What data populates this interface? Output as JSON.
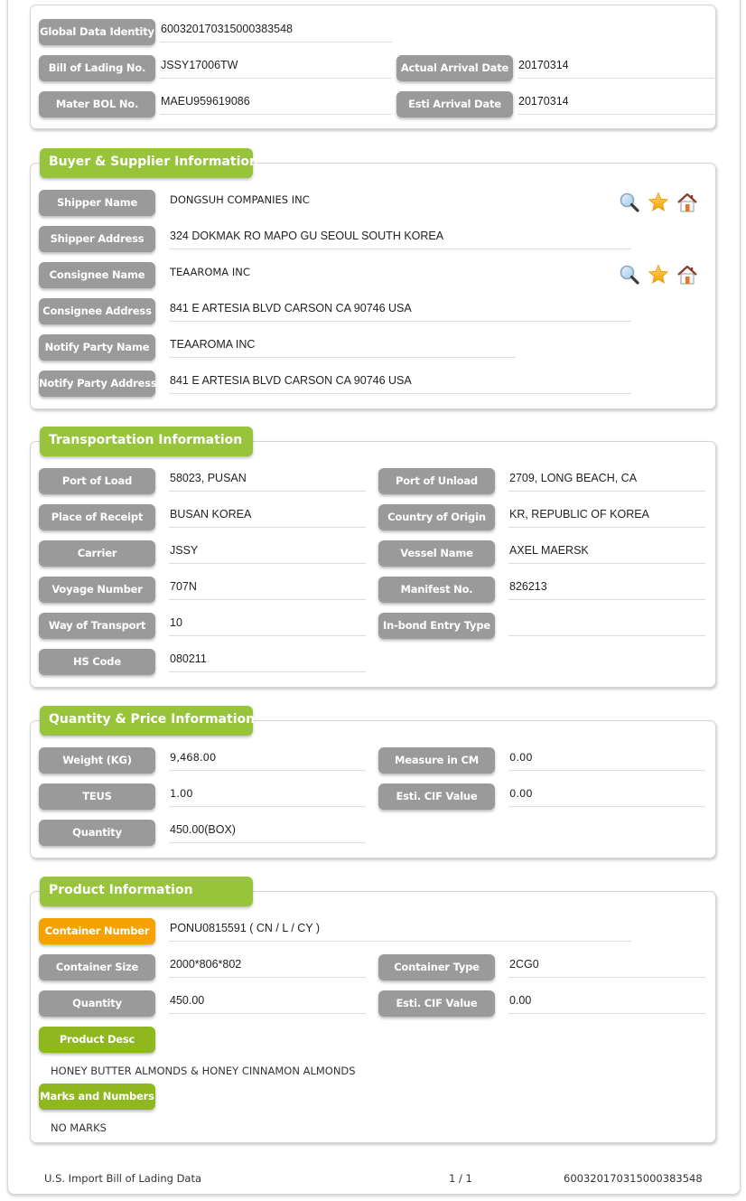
{
  "header": {
    "global_data_identity": {
      "label": "Global Data Identity",
      "value": "600320170315000383548"
    },
    "bill_of_lading": {
      "label": "Bill of Lading No.",
      "value": "JSSY17006TW"
    },
    "master_bol": {
      "label": "Mater BOL No.",
      "value": "MAEU959619086"
    },
    "actual_arrival": {
      "label": "Actual Arrival Date",
      "value": "20170314"
    },
    "esti_arrival": {
      "label": "Esti Arrival Date",
      "value": "20170314"
    }
  },
  "buyer_supplier": {
    "title": "Buyer & Supplier Information",
    "shipper_name": {
      "label": "Shipper Name",
      "value": "DONGSUH COMPANIES INC"
    },
    "shipper_address": {
      "label": "Shipper Address",
      "value": "324 DOKMAK RO MAPO GU SEOUL SOUTH KOREA"
    },
    "consignee_name": {
      "label": "Consignee Name",
      "value": "TEAAROMA INC"
    },
    "consignee_address": {
      "label": "Consignee Address",
      "value": "841 E ARTESIA BLVD CARSON CA 90746 USA"
    },
    "notify_party_name": {
      "label": "Notify Party Name",
      "value": "TEAAROMA INC"
    },
    "notify_party_address": {
      "label": "Notify Party Address",
      "value": "841 E ARTESIA BLVD CARSON CA 90746 USA"
    },
    "action_icons": [
      "search-icon",
      "star-icon",
      "home-icon"
    ]
  },
  "transportation": {
    "title": "Transportation Information",
    "port_of_load": {
      "label": "Port of Load",
      "value": "58023, PUSAN"
    },
    "port_of_unload": {
      "label": "Port of Unload",
      "value": "2709, LONG BEACH, CA"
    },
    "place_of_receipt": {
      "label": "Place of Receipt",
      "value": "BUSAN KOREA"
    },
    "country_of_origin": {
      "label": "Country of Origin",
      "value": "KR, REPUBLIC OF KOREA"
    },
    "carrier": {
      "label": "Carrier",
      "value": "JSSY"
    },
    "vessel_name": {
      "label": "Vessel Name",
      "value": "AXEL MAERSK"
    },
    "voyage_number": {
      "label": "Voyage Number",
      "value": "707N"
    },
    "manifest_no": {
      "label": "Manifest No.",
      "value": "826213"
    },
    "way_of_transport": {
      "label": "Way of Transport",
      "value": "10"
    },
    "inbond_entry_type": {
      "label": "In-bond Entry Type",
      "value": ""
    },
    "hs_code": {
      "label": "HS Code",
      "value": "080211"
    }
  },
  "quantity_price": {
    "title": "Quantity & Price Information",
    "weight": {
      "label": "Weight (KG)",
      "value": "9,468.00"
    },
    "measure": {
      "label": "Measure in CM",
      "value": "0.00"
    },
    "teus": {
      "label": "TEUS",
      "value": "1.00"
    },
    "esti_cif": {
      "label": "Esti. CIF Value",
      "value": "0.00"
    },
    "quantity": {
      "label": "Quantity",
      "value": "450.00(BOX)"
    }
  },
  "product": {
    "title": "Product Information",
    "container_number": {
      "label": "Container Number",
      "value": "PONU0815591 ( CN / L / CY )"
    },
    "container_size": {
      "label": "Container Size",
      "value": "2000*806*802"
    },
    "container_type": {
      "label": "Container Type",
      "value": "2CG0"
    },
    "quantity": {
      "label": "Quantity",
      "value": "450.00"
    },
    "esti_cif": {
      "label": "Esti. CIF Value",
      "value": "0.00"
    },
    "product_desc": {
      "label": "Product Desc",
      "value": "HONEY BUTTER ALMONDS & HONEY CINNAMON ALMONDS"
    },
    "marks_numbers": {
      "label": "Marks and Numbers",
      "value": "NO MARKS"
    }
  },
  "footer": {
    "doc_title": "U.S. Import Bill of Lading Data",
    "page": "1 / 1",
    "identity": "600320170315000383548"
  },
  "colors": {
    "section_header": "#97c43a",
    "label_gray": "#9a9a9a",
    "label_orange": "#f5a100",
    "label_green": "#8fb81e"
  }
}
